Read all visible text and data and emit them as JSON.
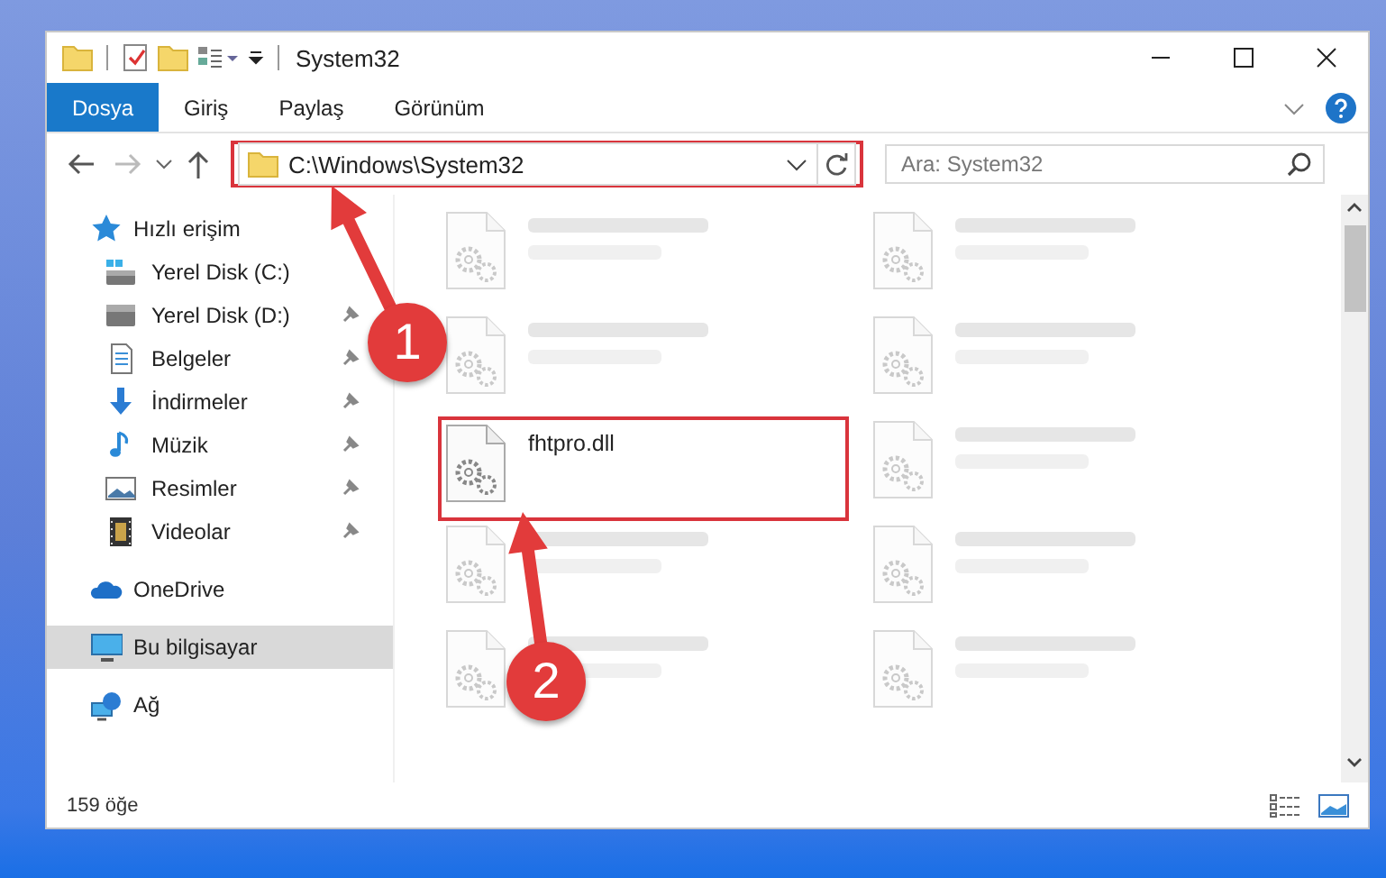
{
  "window": {
    "title": "System32"
  },
  "ribbon_tabs": [
    {
      "label": "Dosya",
      "selected": true
    },
    {
      "label": "Giriş",
      "selected": false
    },
    {
      "label": "Paylaş",
      "selected": false
    },
    {
      "label": "Görünüm",
      "selected": false
    }
  ],
  "address": {
    "path": "C:\\Windows\\System32",
    "annotated": true
  },
  "search": {
    "placeholder": "Ara: System32"
  },
  "sidebar": {
    "items": [
      {
        "label": "Hızlı erişim",
        "kind": "star",
        "selected": false,
        "children": [
          {
            "label": "Yerel Disk (C:)",
            "kind": "drive-c",
            "pinned": false,
            "selected": false
          },
          {
            "label": "Yerel Disk (D:)",
            "kind": "drive",
            "pinned": true,
            "selected": false
          },
          {
            "label": "Belgeler",
            "kind": "documents",
            "pinned": true,
            "selected": false
          },
          {
            "label": "İndirmeler",
            "kind": "downloads",
            "pinned": true,
            "selected": false
          },
          {
            "label": "Müzik",
            "kind": "music",
            "pinned": true,
            "selected": false
          },
          {
            "label": "Resimler",
            "kind": "pictures",
            "pinned": true,
            "selected": false
          },
          {
            "label": "Videolar",
            "kind": "videos",
            "pinned": true,
            "selected": false
          }
        ]
      },
      {
        "label": "OneDrive",
        "kind": "cloud",
        "selected": false
      },
      {
        "label": "Bu bilgisayar",
        "kind": "computer",
        "selected": true
      },
      {
        "label": "Ağ",
        "kind": "network",
        "selected": false
      }
    ]
  },
  "files": [
    {
      "blurred": true,
      "annotated": false
    },
    {
      "blurred": true,
      "annotated": false
    },
    {
      "blurred": true,
      "annotated": false
    },
    {
      "blurred": true,
      "annotated": false
    },
    {
      "name": "fhtpro.dll",
      "blurred": false,
      "annotated": true
    },
    {
      "blurred": true,
      "annotated": false
    },
    {
      "blurred": true,
      "annotated": false
    },
    {
      "blurred": true,
      "annotated": false
    },
    {
      "blurred": true,
      "annotated": false
    },
    {
      "blurred": true,
      "annotated": false
    }
  ],
  "status_bar": {
    "count": "159 öğe"
  },
  "annotations": [
    {
      "number": "1"
    },
    {
      "number": "2"
    }
  ]
}
